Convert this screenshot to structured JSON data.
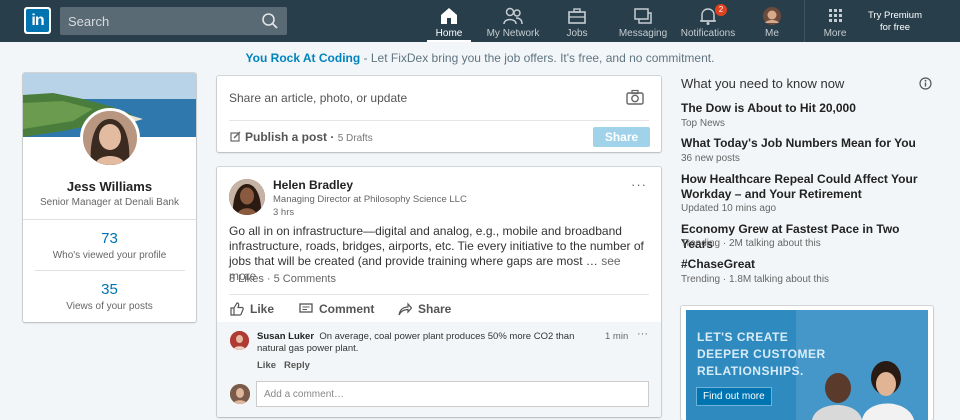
{
  "nav": {
    "search_placeholder": "Search",
    "items": [
      {
        "label": "Home",
        "icon": "home-icon"
      },
      {
        "label": "My Network",
        "icon": "network-icon"
      },
      {
        "label": "Jobs",
        "icon": "briefcase-icon"
      },
      {
        "label": "Messaging",
        "icon": "messaging-icon"
      },
      {
        "label": "Notifications",
        "icon": "bell-icon",
        "badge": "2"
      },
      {
        "label": "Me",
        "icon": "avatar"
      },
      {
        "label": "More",
        "icon": "grid-icon"
      }
    ],
    "premium": [
      "Try Premium",
      "for free"
    ]
  },
  "banner": {
    "link": "You Rock At Coding",
    "rest": " - Let FixDex bring you the job offers. It's free, and no commitment."
  },
  "profile": {
    "name": "Jess Williams",
    "title": "Senior Manager at Denali Bank",
    "stats": [
      {
        "value": "73",
        "label": "Who's viewed your profile"
      },
      {
        "value": "35",
        "label": "Views of your posts"
      }
    ]
  },
  "share": {
    "prompt": "Share an article, photo, or update",
    "publish": "Publish a post",
    "drafts": "5 Drafts",
    "button": "Share"
  },
  "post": {
    "author": "Helen Bradley",
    "subtitle": "Managing Director at Philosophy Science LLC",
    "time": "3 hrs",
    "body": "Go all in on infrastructure—digital and analog, e.g., mobile and broadband infrastructure, roads, bridges, airports, etc. Tie every initiative to the number of jobs that will be created (and provide training where gaps are most …",
    "see_more": "see more",
    "stats": "8 Likes · 5 Comments",
    "actions": [
      "Like",
      "Comment",
      "Share"
    ],
    "comment": {
      "author": "Susan Luker",
      "text": "On average, coal power plant produces 50% more CO2 than natural gas power plant.",
      "time": "1 min",
      "actions": [
        "Like",
        "Reply"
      ]
    },
    "comment_placeholder": "Add a comment…"
  },
  "news": {
    "heading": "What you need to know now",
    "items": [
      {
        "title": "The Dow is About to Hit 20,000",
        "sub": "Top News"
      },
      {
        "title": "What Today's Job Numbers Mean for You",
        "sub": "36 new posts"
      },
      {
        "title": "How Healthcare Repeal Could Affect Your Workday – and Your Retirement",
        "sub": "Updated 10 mins ago"
      },
      {
        "title": "Economy Grew at Fastest Pace in Two Years",
        "sub": "Trending · 2M talking about this"
      },
      {
        "title": "#ChaseGreat",
        "sub": "Trending · 1.8M talking about this"
      }
    ]
  },
  "ad": {
    "lines": [
      "LET'S CREATE",
      "DEEPER CUSTOMER",
      "RELATIONSHIPS."
    ],
    "button": "Find out more"
  }
}
